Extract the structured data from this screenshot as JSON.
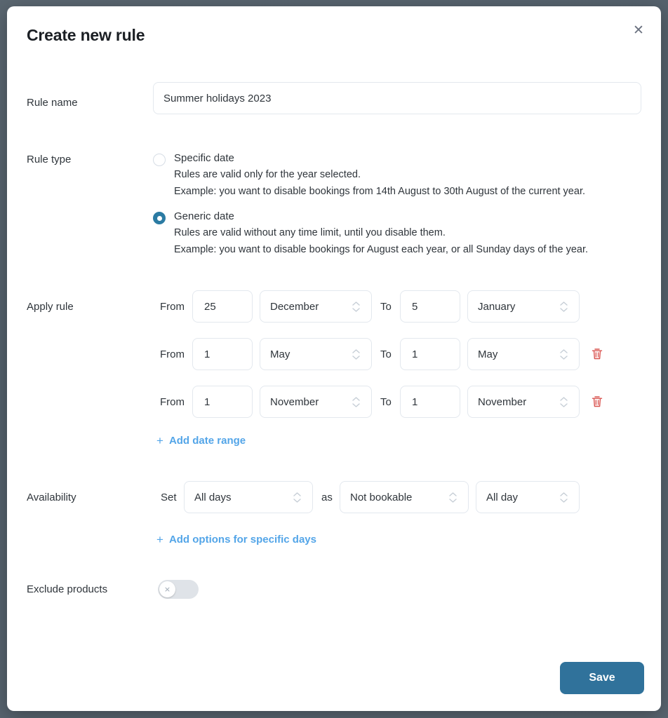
{
  "modal": {
    "title": "Create new rule",
    "close_icon": "close-icon"
  },
  "rule_name": {
    "label": "Rule name",
    "value": "Summer holidays 2023",
    "placeholder": "Rule name"
  },
  "rule_type": {
    "label": "Rule type",
    "options": [
      {
        "title": "Specific date",
        "desc1": "Rules are valid only for the year selected.",
        "desc2": "Example: you want to disable bookings from 14th August to 30th August of the current year.",
        "selected": false
      },
      {
        "title": "Generic date",
        "desc1": "Rules are valid without any time limit, until you disable them.",
        "desc2": "Example: you want to disable bookings for August each year, or all Sunday days of the year.",
        "selected": true
      }
    ]
  },
  "apply_rule": {
    "label": "Apply rule",
    "from_label": "From",
    "to_label": "To",
    "add_link": "Add date range",
    "add_link_plus": "+",
    "rows": [
      {
        "from_day": "25",
        "from_month": "December",
        "to_day": "5",
        "to_month": "January",
        "deletable": false
      },
      {
        "from_day": "1",
        "from_month": "May",
        "to_day": "1",
        "to_month": "May",
        "deletable": true
      },
      {
        "from_day": "1",
        "from_month": "November",
        "to_day": "1",
        "to_month": "November",
        "deletable": true
      }
    ]
  },
  "availability": {
    "label": "Availability",
    "set_label": "Set",
    "as_label": "as",
    "days_value": "All days",
    "status_value": "Not bookable",
    "time_value": "All day",
    "add_link": "Add options for specific days",
    "add_link_plus": "+"
  },
  "exclude_products": {
    "label": "Exclude products",
    "toggle_state": "off",
    "toggle_glyph": "×"
  },
  "footer": {
    "save_label": "Save"
  },
  "colors": {
    "accent": "#30729b",
    "link": "#53a5e8",
    "danger": "#d9534f",
    "backdrop": "#53606b"
  }
}
